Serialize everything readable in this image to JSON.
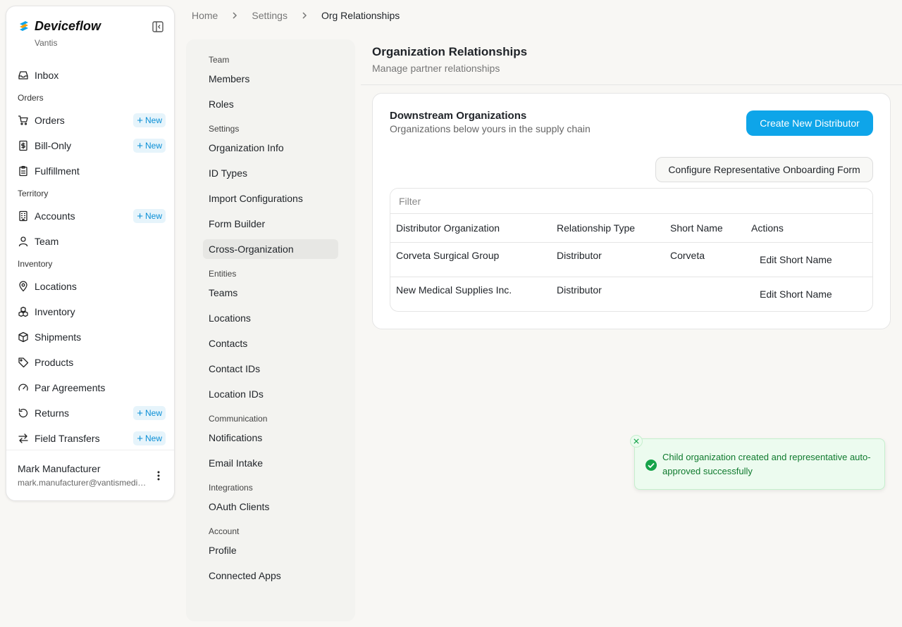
{
  "app": {
    "brand": "Deviceflow",
    "org": "Vantis"
  },
  "sidebar": {
    "new_label": "New",
    "items": [
      {
        "type": "item",
        "label": "Inbox",
        "icon": "inbox-icon"
      },
      {
        "type": "section",
        "label": "Orders"
      },
      {
        "type": "item",
        "label": "Orders",
        "icon": "cart-icon",
        "badge": true
      },
      {
        "type": "item",
        "label": "Bill-Only",
        "icon": "receipt-icon",
        "badge": true
      },
      {
        "type": "item",
        "label": "Fulfillment",
        "icon": "clipboard-icon"
      },
      {
        "type": "section",
        "label": "Territory"
      },
      {
        "type": "item",
        "label": "Accounts",
        "icon": "building-icon",
        "badge": true
      },
      {
        "type": "item",
        "label": "Team",
        "icon": "user-icon"
      },
      {
        "type": "section",
        "label": "Inventory"
      },
      {
        "type": "item",
        "label": "Locations",
        "icon": "map-pin-icon"
      },
      {
        "type": "item",
        "label": "Inventory",
        "icon": "boxes-icon"
      },
      {
        "type": "item",
        "label": "Shipments",
        "icon": "package-icon"
      },
      {
        "type": "item",
        "label": "Products",
        "icon": "tag-icon"
      },
      {
        "type": "item",
        "label": "Par Agreements",
        "icon": "gauge-icon"
      },
      {
        "type": "item",
        "label": "Returns",
        "icon": "rotate-icon",
        "badge": true
      },
      {
        "type": "item",
        "label": "Field Transfers",
        "icon": "arrows-swap-icon",
        "badge": true
      }
    ]
  },
  "user": {
    "name": "Mark Manufacturer",
    "email": "mark.manufacturer@vantismedical.com"
  },
  "breadcrumb": [
    "Home",
    "Settings",
    "Org Relationships"
  ],
  "settings_nav": {
    "sections": [
      {
        "label": "Team",
        "items": [
          "Members",
          "Roles"
        ]
      },
      {
        "label": "Settings",
        "items": [
          "Organization Info",
          "ID Types",
          "Import Configurations",
          "Form Builder",
          "Cross-Organization"
        ]
      },
      {
        "label": "Entities",
        "items": [
          "Teams",
          "Locations",
          "Contacts",
          "Contact IDs",
          "Location IDs"
        ]
      },
      {
        "label": "Communication",
        "items": [
          "Notifications",
          "Email Intake"
        ]
      },
      {
        "label": "Integrations",
        "items": [
          "OAuth Clients"
        ]
      },
      {
        "label": "Account",
        "items": [
          "Profile",
          "Connected Apps"
        ]
      }
    ],
    "active": "Cross-Organization"
  },
  "page": {
    "title": "Organization Relationships",
    "subtitle": "Manage partner relationships"
  },
  "card": {
    "title": "Downstream Organizations",
    "subtitle": "Organizations below yours in the supply chain",
    "create_button": "Create New Distributor",
    "configure_button": "Configure Representative Onboarding Form",
    "filter_placeholder": "Filter",
    "columns": [
      "Distributor Organization",
      "Relationship Type",
      "Short Name",
      "Actions"
    ],
    "rows": [
      {
        "org": "Corveta Surgical Group",
        "type": "Distributor",
        "short_name": "Corveta",
        "action": "Edit Short Name"
      },
      {
        "org": "New Medical Supplies Inc.",
        "type": "Distributor",
        "short_name": "",
        "action": "Edit Short Name"
      }
    ]
  },
  "toast": {
    "message": "Child organization created and representative auto-approved successfully",
    "status": "success",
    "color": "#0f7a2e"
  },
  "colors": {
    "accent": "#0ea5e9",
    "badge_bg": "#e6f4fb",
    "badge_text": "#0a8fd6"
  }
}
